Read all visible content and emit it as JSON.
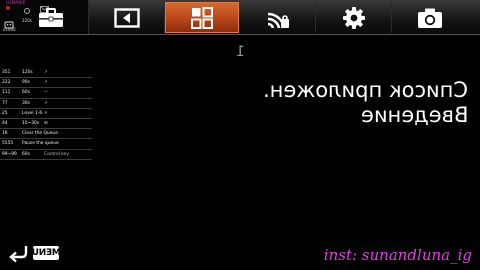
{
  "status": {
    "logo": "LOMANIE",
    "items": [
      "x1000",
      "120s"
    ]
  },
  "tabs": [
    {
      "name": "toolbox",
      "icon": "toolbox-icon",
      "active": false
    },
    {
      "name": "screen",
      "icon": "screen-icon",
      "active": false
    },
    {
      "name": "apps",
      "icon": "grid-icon",
      "active": true
    },
    {
      "name": "wireless",
      "icon": "wifi-icon",
      "active": false
    },
    {
      "name": "settings",
      "icon": "gear-icon",
      "active": false
    },
    {
      "name": "camera",
      "icon": "camera-icon",
      "active": false
    }
  ],
  "table": {
    "rows": [
      {
        "c1": "351",
        "c2": "120s",
        "c3": "↗"
      },
      {
        "c1": "222",
        "c2": "90s",
        "c3": "↗"
      },
      {
        "c1": "111",
        "c2": "60s",
        "c3": "~"
      },
      {
        "c1": "77",
        "c2": "30s",
        "c3": "↗"
      },
      {
        "c1": "25",
        "c2": "Level 1-6",
        "c3": "✕"
      },
      {
        "c1": "44",
        "c2": "10~30s",
        "c3": "⊞"
      },
      {
        "c1": "1K",
        "c2": "Clear the Queue",
        "c3": ""
      },
      {
        "c1": "5555",
        "c2": "Pause the queue",
        "c3": ""
      },
      {
        "c1": "99~99",
        "c2": "60s",
        "c3": "Control key"
      }
    ]
  },
  "main": {
    "indicator": "1",
    "line1": "Список приложен.",
    "line2": "Введение"
  },
  "bottom": {
    "menu_label": "MENU",
    "watermark": "inst: sunandluna_ig"
  },
  "colors": {
    "active_tab": "#c0501f",
    "watermark": "#e040e0"
  }
}
